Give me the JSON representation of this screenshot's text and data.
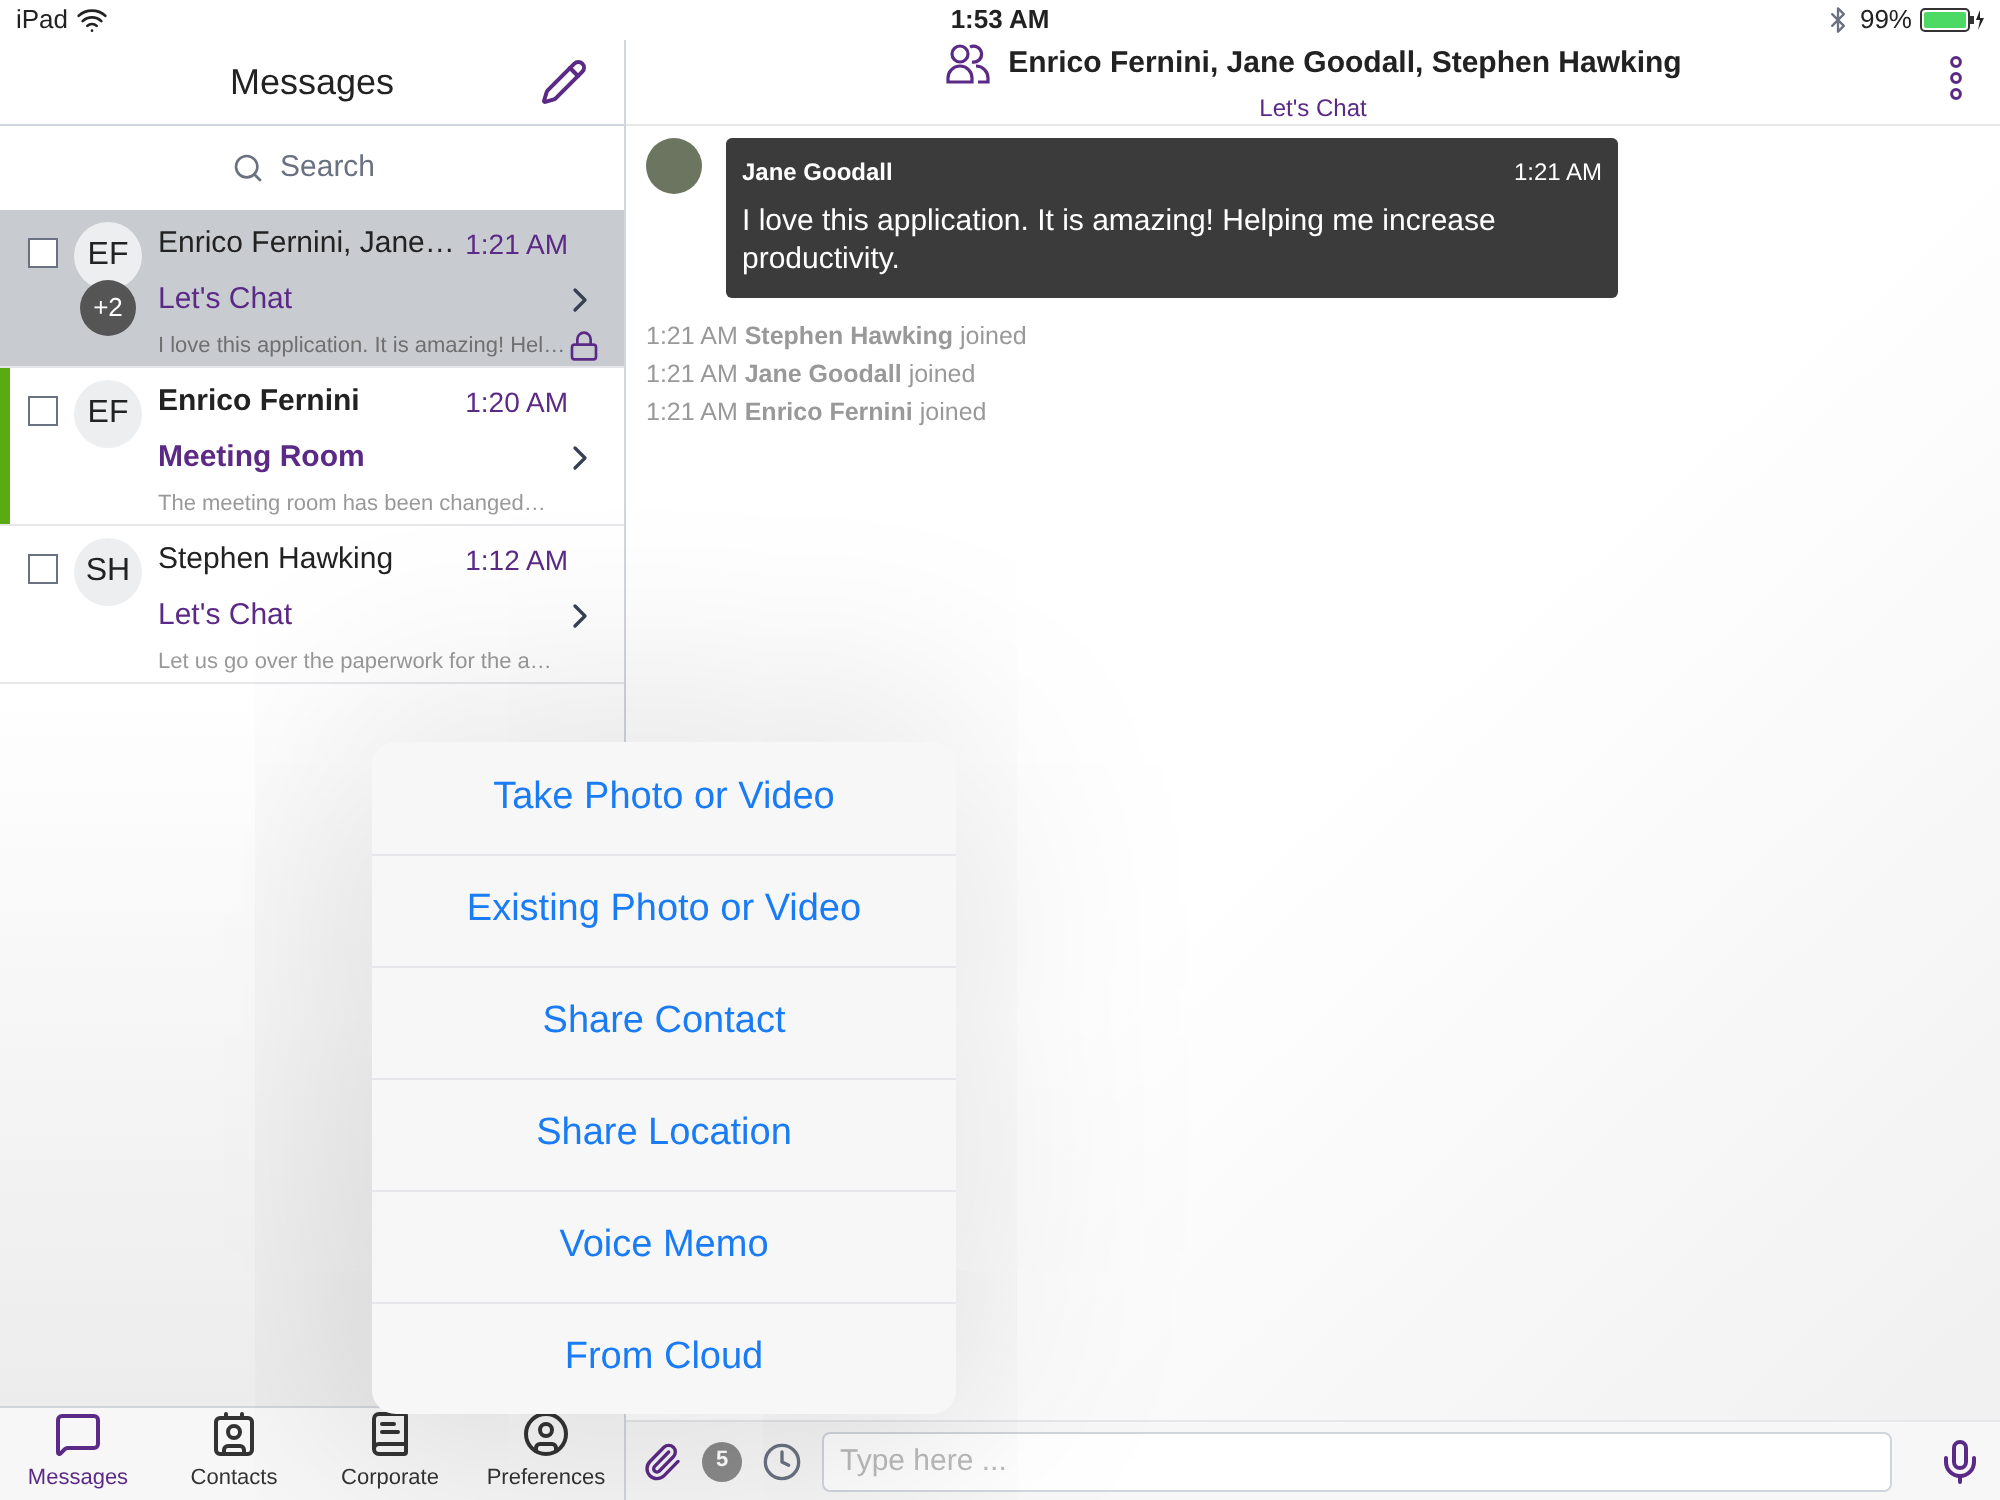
{
  "status_bar": {
    "device": "iPad",
    "time": "1:53 AM",
    "battery": "99%"
  },
  "sidebar": {
    "title": "Messages",
    "search": {
      "placeholder": "Search"
    },
    "conversations": [
      {
        "initials": "EF",
        "extra_badge": "+2",
        "name": "Enrico Fernini, Jane…",
        "time": "1:21 AM",
        "subject": "Let's Chat",
        "preview": "I love this application. It is amazing! Hel…",
        "selected": true,
        "unread": false,
        "locked": true,
        "checked": false
      },
      {
        "initials": "EF",
        "name": "Enrico Fernini",
        "time": "1:20 AM",
        "subject": "Meeting Room",
        "preview": "The meeting room has been changed…",
        "selected": false,
        "unread": true,
        "locked": false,
        "checked": false
      },
      {
        "initials": "SH",
        "name": "Stephen Hawking",
        "time": "1:12 AM",
        "subject": "Let's Chat",
        "preview": "Let us go over the paperwork for the a…",
        "selected": false,
        "unread": false,
        "locked": false,
        "checked": false
      }
    ]
  },
  "tab_bar": [
    {
      "label": "Messages",
      "selected": true
    },
    {
      "label": "Contacts",
      "selected": false
    },
    {
      "label": "Corporate",
      "selected": false
    },
    {
      "label": "Preferences",
      "selected": false
    }
  ],
  "chat": {
    "participants": "Enrico Fernini, Jane Goodall, Stephen Hawking",
    "subject": "Let's Chat",
    "messages": [
      {
        "kind": "bubble",
        "sender": "Jane Goodall",
        "time": "1:21 AM",
        "text": "I love this application. It is amazing! Helping me increase productivity."
      },
      {
        "kind": "event",
        "text": "1:21 AM **Stephen Hawking** joined"
      },
      {
        "kind": "event",
        "text": "1:21 AM **Jane Goodall** joined"
      },
      {
        "kind": "event",
        "text": "1:21 AM **Enrico Fernini** joined"
      }
    ],
    "input": {
      "placeholder": "Type here ...",
      "timer": "5"
    }
  },
  "attach_menu": [
    "Take Photo or Video",
    "Existing Photo or Video",
    "Share Contact",
    "Share Location",
    "Voice Memo",
    "From Cloud"
  ]
}
